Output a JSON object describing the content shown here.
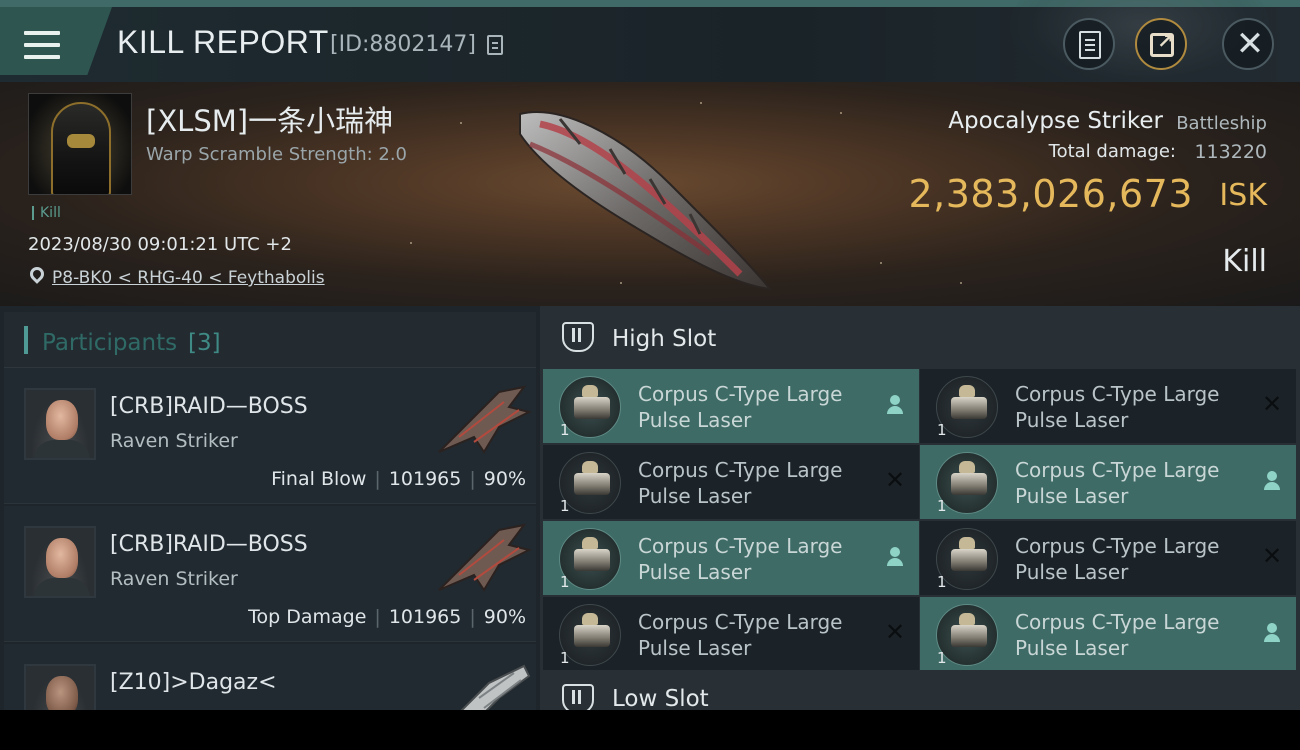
{
  "header": {
    "title": "KILL REPORT",
    "report_id": "[ID:8802147]",
    "icons": [
      "menu-icon",
      "copy-icon",
      "notes-icon",
      "share-icon",
      "close-icon"
    ],
    "close_glyph": "✕"
  },
  "victim": {
    "name": "[XLSM]一条小瑞神",
    "warp_scramble": "Warp Scramble Strength: 2.0",
    "tag": "Kill",
    "datetime": "2023/08/30 09:01:21 UTC +2",
    "location": "P8-BK0 < RHG-40 < Feythabolis",
    "ship_name": "Apocalypse Striker",
    "ship_class": "Battleship",
    "damage_label": "Total damage:",
    "damage_value": "113220",
    "isk_value": "2,383,026,673",
    "isk_unit": "ISK",
    "result": "Kill"
  },
  "participants": {
    "title": "Participants",
    "count": "[3]",
    "items": [
      {
        "name": "[CRB]RAID—BOSS",
        "ship": "Raven Striker",
        "role": "Final Blow",
        "damage": "101965",
        "percent": "90%"
      },
      {
        "name": "[CRB]RAID—BOSS",
        "ship": "Raven Striker",
        "role": "Top Damage",
        "damage": "101965",
        "percent": "90%"
      },
      {
        "name": "[Z10]>Dagaz<",
        "ship": "",
        "role": "",
        "damage": "",
        "percent": ""
      }
    ]
  },
  "slots": {
    "high_label": "High Slot",
    "low_label": "Low Slot",
    "modules": [
      {
        "line1": "Corpus C-Type Large",
        "line2": "Pulse Laser",
        "qty": "1",
        "status": "dropped"
      },
      {
        "line1": "Corpus C-Type Large",
        "line2": "Pulse Laser",
        "qty": "1",
        "status": "destroyed"
      },
      {
        "line1": "Corpus C-Type Large",
        "line2": "Pulse Laser",
        "qty": "1",
        "status": "destroyed"
      },
      {
        "line1": "Corpus C-Type Large",
        "line2": "Pulse Laser",
        "qty": "1",
        "status": "dropped"
      },
      {
        "line1": "Corpus C-Type Large",
        "line2": "Pulse Laser",
        "qty": "1",
        "status": "dropped"
      },
      {
        "line1": "Corpus C-Type Large",
        "line2": "Pulse Laser",
        "qty": "1",
        "status": "destroyed"
      },
      {
        "line1": "Corpus C-Type Large",
        "line2": "Pulse Laser",
        "qty": "1",
        "status": "destroyed"
      },
      {
        "line1": "Corpus C-Type Large",
        "line2": "Pulse Laser",
        "qty": "1",
        "status": "dropped"
      }
    ],
    "destroyed_glyph": "✕"
  },
  "colors": {
    "accent_teal": "#3e6b66",
    "isk_gold": "#e5b85c",
    "background": "#1c2227"
  }
}
